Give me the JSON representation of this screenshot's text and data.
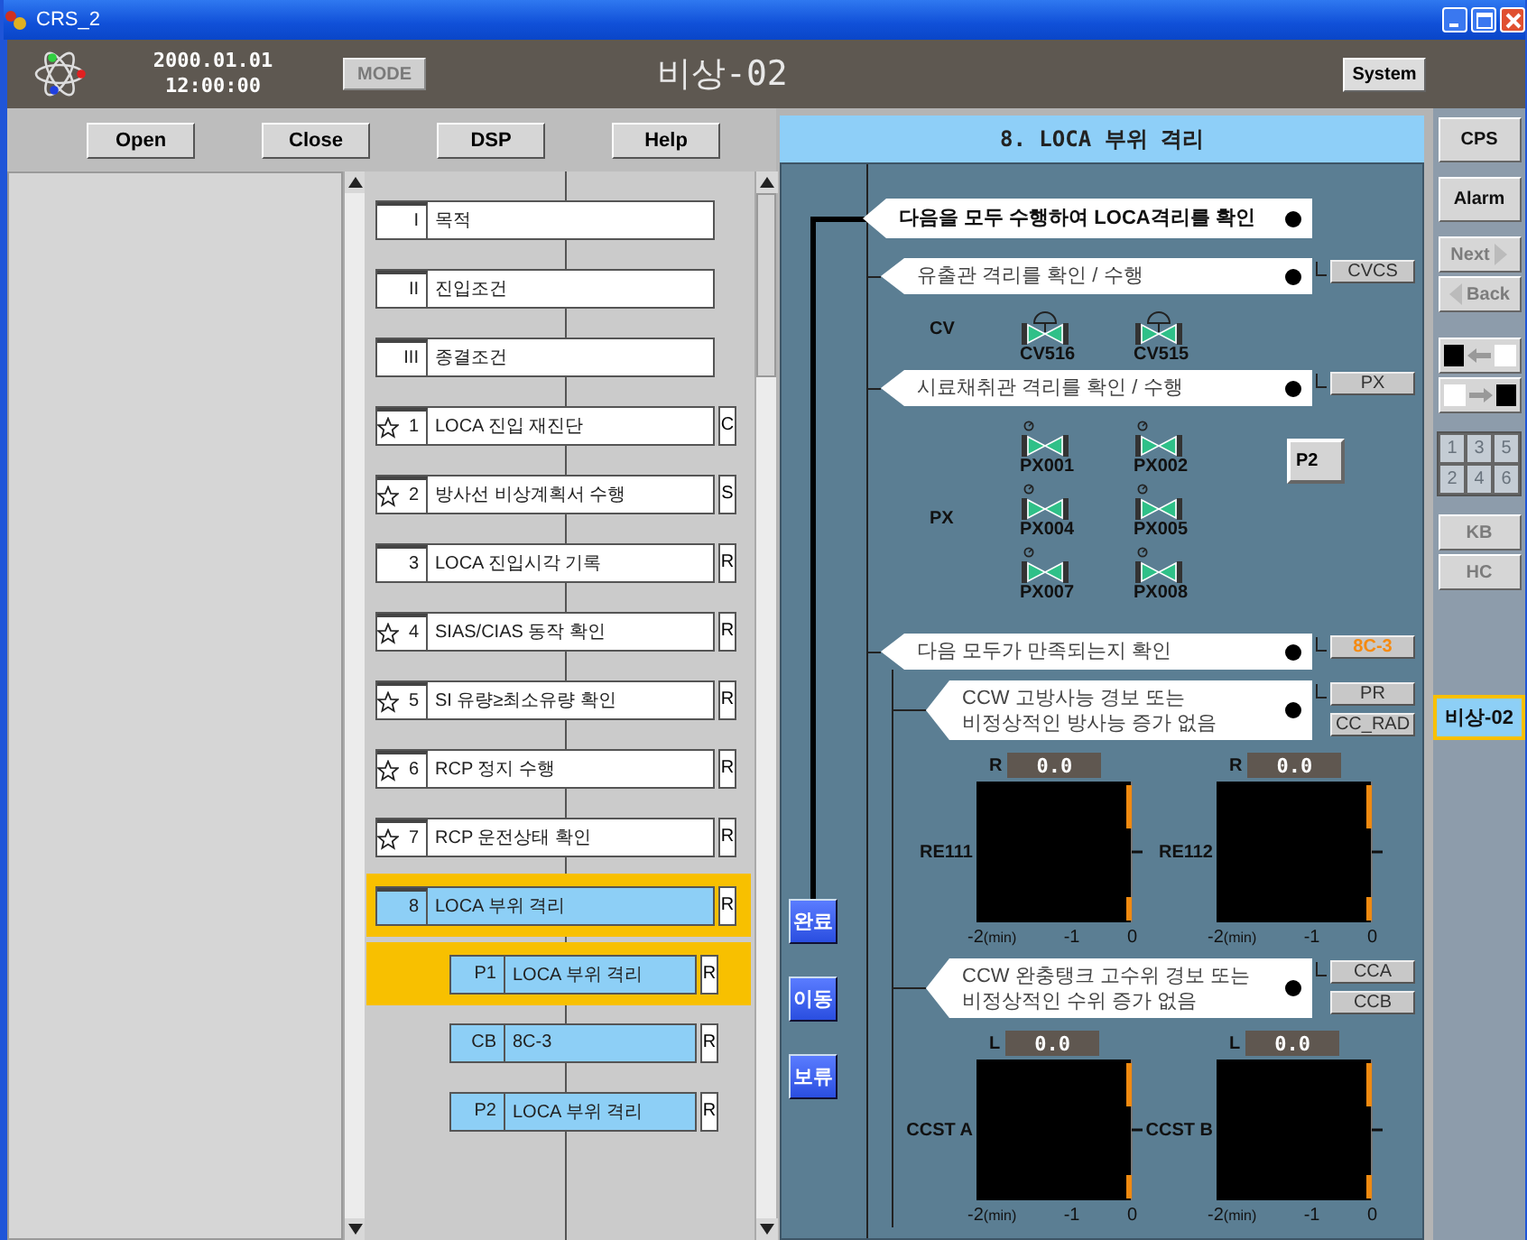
{
  "window": {
    "title": "CRS_2"
  },
  "header": {
    "date": "2000.01.01",
    "time": "12:00:00",
    "mode_button": {
      "label": "MODE",
      "disabled": true
    },
    "title": "비상-02",
    "system_button": "System"
  },
  "toolbar": [
    "Open",
    "Close",
    "DSP",
    "Help"
  ],
  "procedure_steps": [
    {
      "number": "I",
      "starred": false,
      "label": "목적",
      "active": false,
      "selected": false
    },
    {
      "number": "II",
      "starred": false,
      "label": "진입조건",
      "active": false,
      "selected": false
    },
    {
      "number": "III",
      "starred": false,
      "label": "종결조건",
      "active": false,
      "selected": false
    },
    {
      "number": "1",
      "starred": true,
      "label": "LOCA 진입 재진단",
      "tag": "C",
      "active": false,
      "selected": false
    },
    {
      "number": "2",
      "starred": true,
      "label": "방사선 비상계획서 수행",
      "tag": "S",
      "active": false,
      "selected": false
    },
    {
      "number": "3",
      "starred": false,
      "label": "LOCA 진입시각 기록",
      "tag": "R",
      "active": false,
      "selected": false
    },
    {
      "number": "4",
      "starred": true,
      "label": "SIAS/CIAS 동작 확인",
      "tag": "R",
      "active": false,
      "selected": false
    },
    {
      "number": "5",
      "starred": true,
      "label": "SI 유량≥최소유량 확인",
      "tag": "R",
      "active": false,
      "selected": false
    },
    {
      "number": "6",
      "starred": true,
      "label": "RCP 정지 수행",
      "tag": "R",
      "active": false,
      "selected": false
    },
    {
      "number": "7",
      "starred": true,
      "label": "RCP 운전상태 확인",
      "tag": "R",
      "active": false,
      "selected": false
    },
    {
      "number": "8",
      "starred": false,
      "label": "LOCA 부위 격리",
      "tag": "R",
      "active": true,
      "selected": true,
      "children": [
        {
          "number": "P1",
          "starred": false,
          "label": "LOCA 부위 격리",
          "tag": "R",
          "active": true,
          "selected": true
        },
        {
          "number": "CB",
          "starred": false,
          "label": "8C-3",
          "tag": "R",
          "active": true,
          "selected": false
        },
        {
          "number": "P2",
          "starred": false,
          "label": "LOCA 부위 격리",
          "tag": "R",
          "active": true,
          "selected": false
        }
      ]
    }
  ],
  "panel": {
    "title": "8. LOCA 부위 격리",
    "side_buttons": [
      "완료",
      "이동",
      "보류"
    ],
    "step": {
      "text": "다음을 모두 수행하여 LOCA격리를 확인",
      "children": [
        {
          "text": "유출관 격리를 확인 / 수행",
          "tags": [
            {
              "label": "CVCS",
              "alert": false
            }
          ],
          "valve_group": {
            "label": "CV",
            "valves": [
              {
                "label": "CV516",
                "kind": "actuated"
              },
              {
                "label": "CV515",
                "kind": "actuated"
              }
            ]
          }
        },
        {
          "text": "시료채취관 격리를 확인 / 수행",
          "tags": [
            {
              "label": "PX",
              "alert": false
            }
          ],
          "valve_group": {
            "label": "PX",
            "button": "P2",
            "valves": [
              {
                "label": "PX001",
                "kind": "marked"
              },
              {
                "label": "PX002",
                "kind": "marked"
              },
              {
                "label": "PX004",
                "kind": "marked"
              },
              {
                "label": "PX005",
                "kind": "marked"
              },
              {
                "label": "PX007",
                "kind": "marked"
              },
              {
                "label": "PX008",
                "kind": "marked"
              }
            ]
          }
        },
        {
          "text": "다음 모두가 만족되는지 확인",
          "tags": [
            {
              "label": "8C-3",
              "alert": true
            }
          ],
          "children": [
            {
              "text": "CCW 고방사능 경보 또는\n비정상적인 방사능 증가 없음",
              "tags": [
                {
                  "label": "PR",
                  "alert": false
                },
                {
                  "label": "CC_RAD",
                  "alert": false
                }
              ],
              "trends": [
                {
                  "name": "RE111",
                  "reading_label": "R",
                  "reading": "0.0",
                  "x_ticks": [
                    "-2",
                    "-1",
                    "0"
                  ],
                  "x_unit": "(min)"
                },
                {
                  "name": "RE112",
                  "reading_label": "R",
                  "reading": "0.0",
                  "x_ticks": [
                    "-2",
                    "-1",
                    "0"
                  ],
                  "x_unit": "(min)"
                }
              ]
            },
            {
              "text": "CCW 완충탱크 고수위 경보 또는\n비정상적인 수위 증가 없음",
              "tags": [
                {
                  "label": "CCA",
                  "alert": false
                },
                {
                  "label": "CCB",
                  "alert": false
                }
              ],
              "trends": [
                {
                  "name": "CCST A",
                  "reading_label": "L",
                  "reading": "0.0",
                  "x_ticks": [
                    "-2",
                    "-1",
                    "0"
                  ],
                  "x_unit": "(min)"
                },
                {
                  "name": "CCST B",
                  "reading_label": "L",
                  "reading": "0.0",
                  "x_ticks": [
                    "-2",
                    "-1",
                    "0"
                  ],
                  "x_unit": "(min)"
                }
              ]
            }
          ]
        }
      ]
    }
  },
  "right_bar": {
    "buttons": [
      {
        "label": "CPS",
        "disabled": false
      },
      {
        "label": "Alarm",
        "disabled": false
      }
    ],
    "nav": [
      {
        "label": "Next",
        "kind": "next",
        "disabled": true
      },
      {
        "label": "Back",
        "kind": "back",
        "disabled": true
      }
    ],
    "swap_buttons": [
      {
        "kind": "to-left"
      },
      {
        "kind": "to-right"
      }
    ],
    "keypad": [
      {
        "label": "1",
        "disabled": true
      },
      {
        "label": "3",
        "disabled": true
      },
      {
        "label": "5",
        "disabled": true
      },
      {
        "label": "2",
        "disabled": true
      },
      {
        "label": "4",
        "disabled": true
      },
      {
        "label": "6",
        "disabled": true
      }
    ],
    "tools": [
      {
        "label": "KB",
        "disabled": true
      },
      {
        "label": "HC",
        "disabled": true
      }
    ],
    "tab": {
      "label": "비상-02",
      "selected": true
    }
  }
}
